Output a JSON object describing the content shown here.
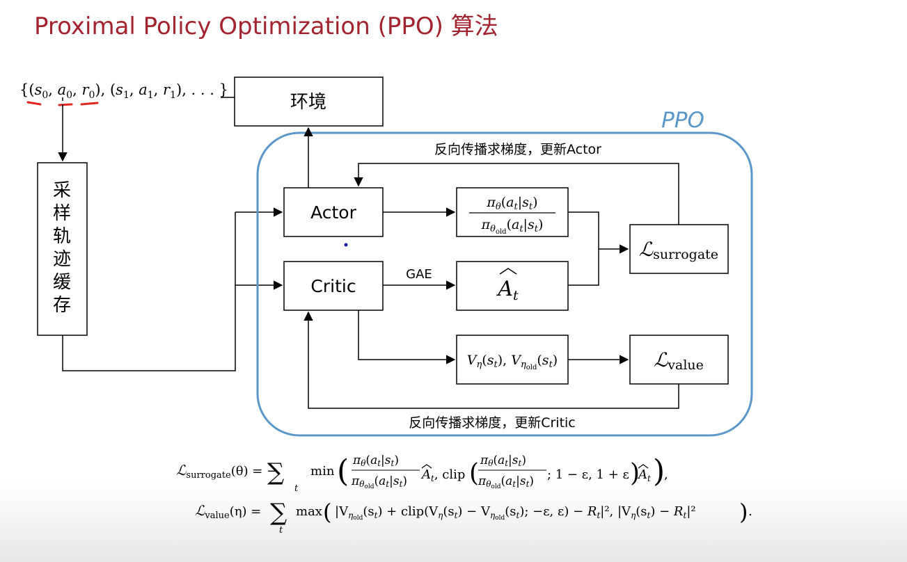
{
  "title": "Proximal Policy Optimization (PPO) 算法",
  "trajectory": {
    "text_open": "{(",
    "s0": "s",
    "s0_sub": "0",
    "a0": "a",
    "a0_sub": "0",
    "r0": "r",
    "r0_sub": "0",
    "mid": "), (",
    "s1": "s",
    "s1_sub": "1",
    "a1": "a",
    "a1_sub": "1",
    "r1": "r",
    "r1_sub": "1",
    "text_close": "), . . . }",
    "comma": ", "
  },
  "boxes": {
    "environment": "环境",
    "buffer_chars": [
      "采",
      "样",
      "轨",
      "迹",
      "缓",
      "存"
    ],
    "actor": "Actor",
    "critic": "Critic"
  },
  "ppo_label": "PPO",
  "edge_labels": {
    "gae": "GAE",
    "actor_grad": "反向传播求梯度，更新Actor",
    "critic_grad": "反向传播求梯度，更新Critic"
  },
  "math": {
    "pi": "π",
    "theta": "θ",
    "old": "old",
    "a_t": "a",
    "s_t": "s",
    "t": "t",
    "A": "A",
    "V": "V",
    "eta": "η",
    "L": "ℒ",
    "surrogate": "surrogate",
    "value": "value"
  },
  "formulas": {
    "surrogate_lhs": "ℒ",
    "surrogate_sub": "surrogate",
    "surrogate_arg": "(θ) = −",
    "surrogate_min": "min",
    "clip": "clip",
    "clip_range": "; 1 − ε, 1 + ε",
    "value_lhs": "ℒ",
    "value_sub": "value",
    "value_arg": "(η) =",
    "value_max": "max",
    "value_body_a": "|V",
    "value_body_b": "(s",
    "value_body_c": ") + clip(V",
    "value_body_d": ") − V",
    "value_body_e": "; −ε, ε) − ",
    "value_body_f": "|², |V",
    "value_body_g": ") − ",
    "value_body_h": "|²",
    "R": "R",
    "end_comma": ",",
    "end_period": "."
  }
}
